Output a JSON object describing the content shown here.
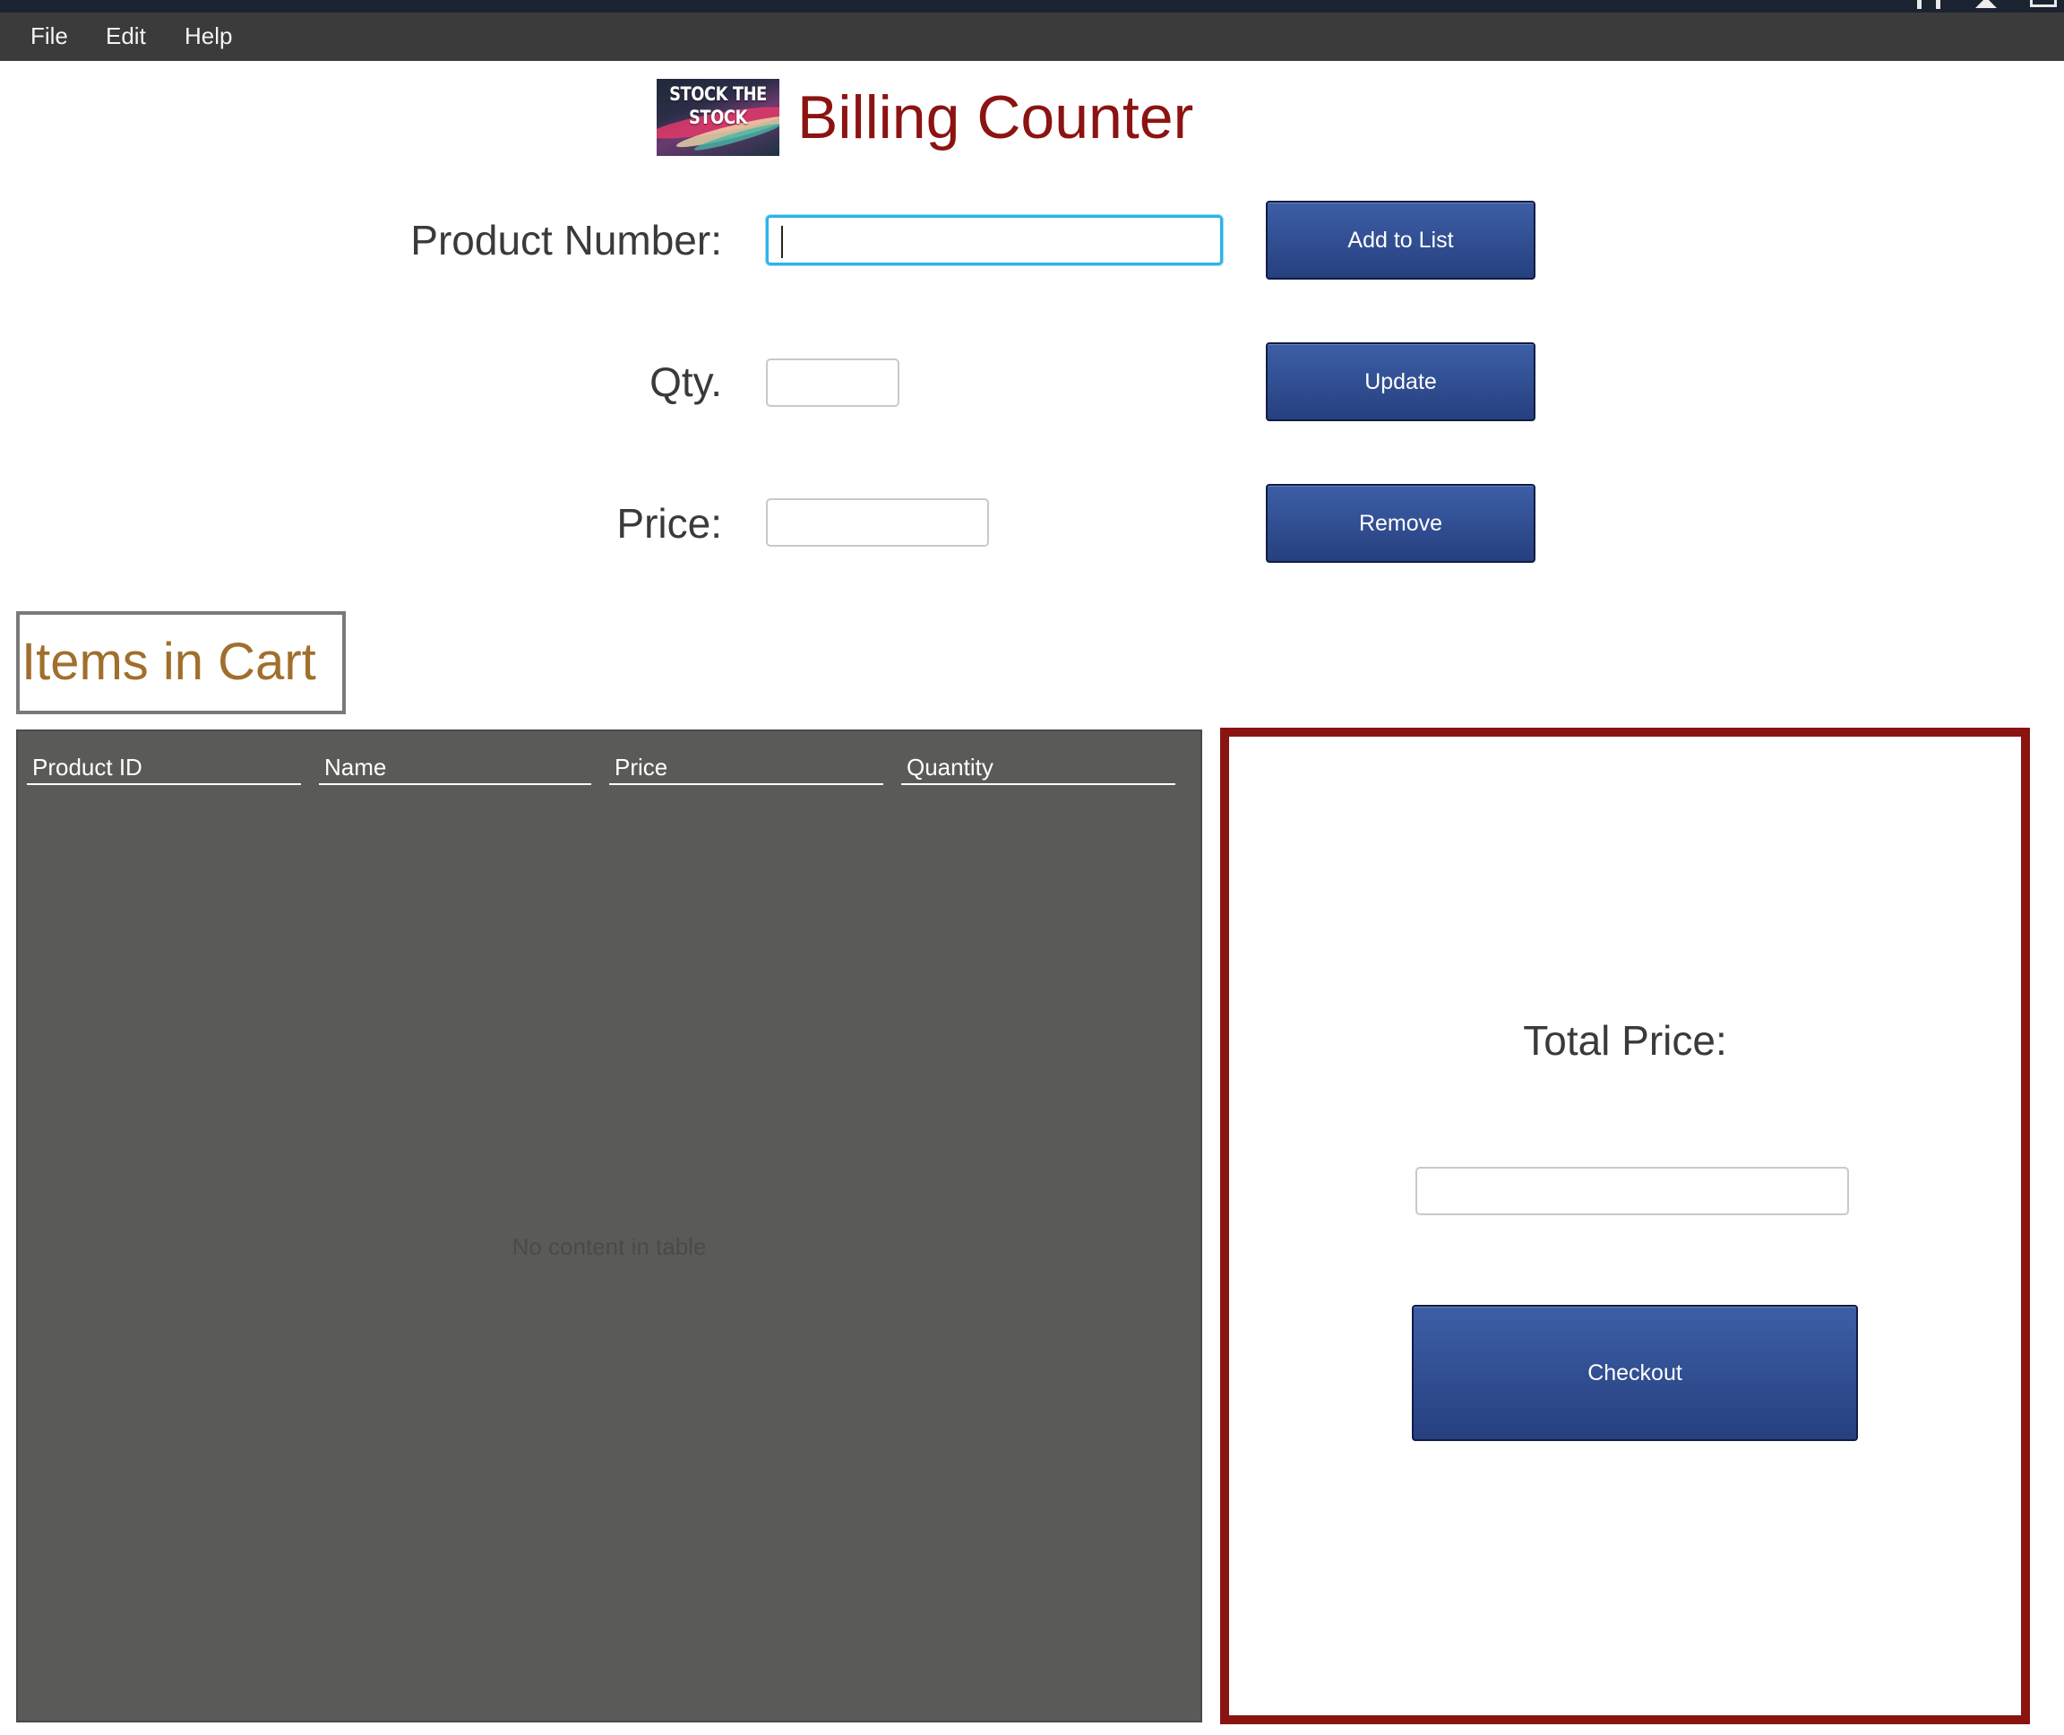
{
  "menubar": {
    "items": [
      "File",
      "Edit",
      "Help"
    ]
  },
  "header": {
    "logo_text": "STOCK THE STOCK",
    "title": "Billing Counter"
  },
  "form": {
    "product_number": {
      "label": "Product Number:",
      "value": ""
    },
    "qty": {
      "label": "Qty.",
      "value": ""
    },
    "price": {
      "label": "Price:",
      "value": ""
    },
    "buttons": {
      "add": "Add to List",
      "update": "Update",
      "remove": "Remove"
    }
  },
  "cart": {
    "heading": "Items in Cart",
    "columns": [
      "Product ID",
      "Name",
      "Price",
      "Quantity"
    ],
    "rows": [],
    "empty_text": "No content in table"
  },
  "total": {
    "label": "Total Price:",
    "value": "",
    "checkout_label": "Checkout"
  },
  "colors": {
    "menubar": "#3b3b3b",
    "title": "#8b1412",
    "cart_heading": "#a06f2c",
    "button": "#2f4c92",
    "table_bg": "#5a5a58",
    "total_border": "#8a1412",
    "focus": "#2bb4e8"
  }
}
